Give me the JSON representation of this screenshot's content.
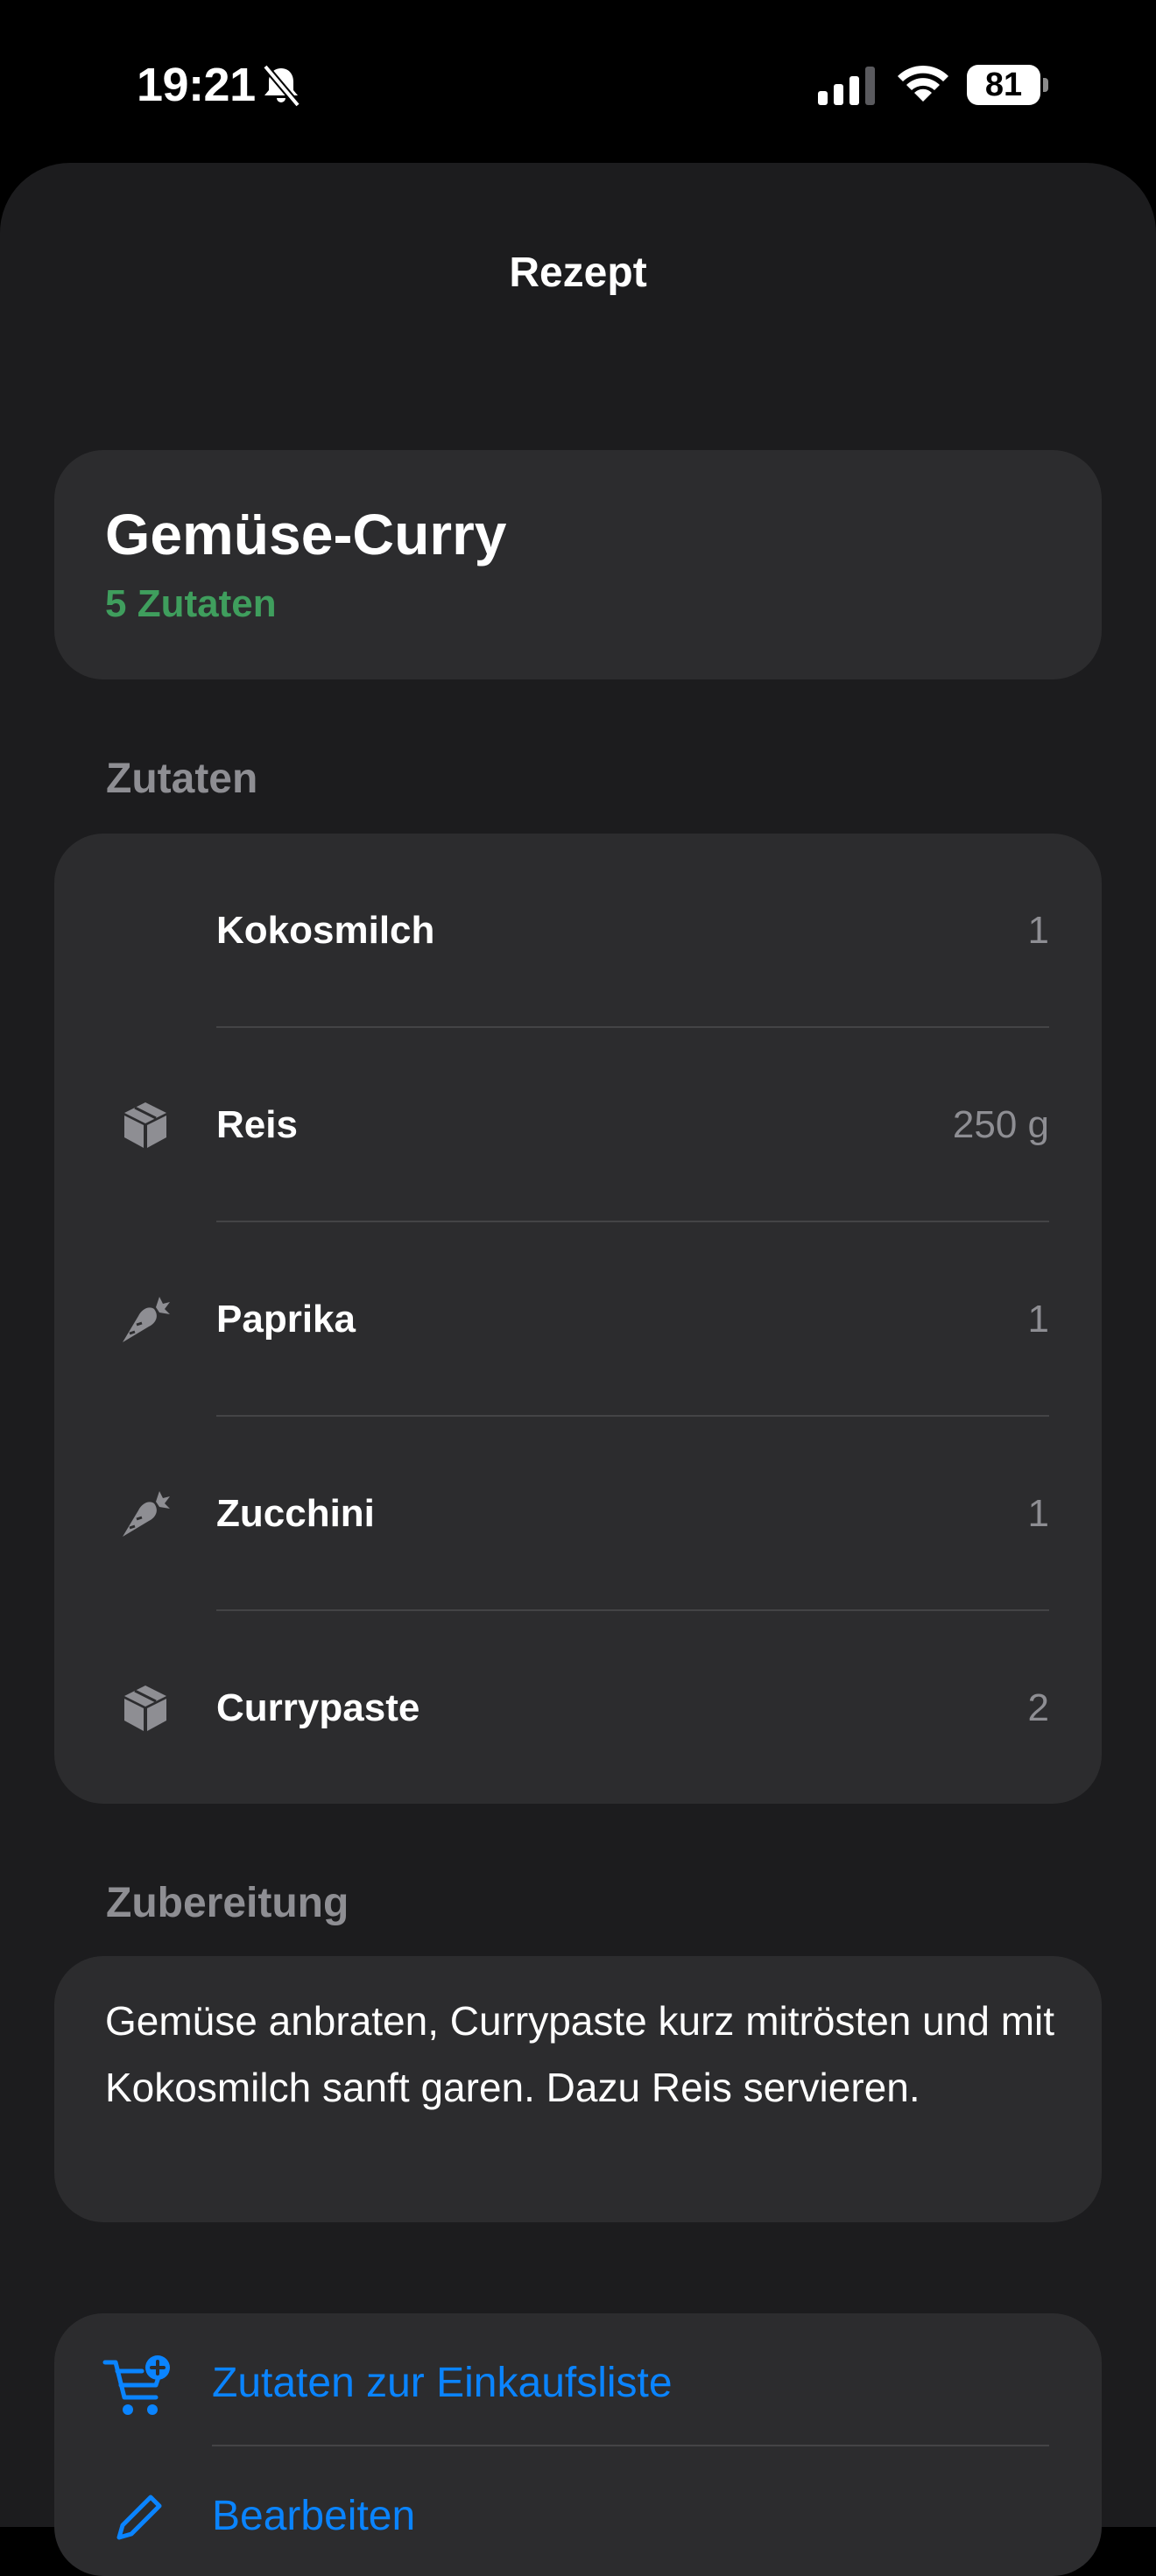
{
  "status_bar": {
    "time": "19:21",
    "battery_level": "81",
    "icons": [
      "bell-slash-icon",
      "cellular-signal-icon",
      "wifi-icon",
      "battery-icon"
    ]
  },
  "nav": {
    "title": "Rezept"
  },
  "recipe": {
    "name": "Gemüse-Curry",
    "ingredient_count": "5 Zutaten",
    "accent_color": "#3f9e5d"
  },
  "ingredients": {
    "header": "Zutaten",
    "items": [
      {
        "name": "Kokosmilch",
        "quantity": "1",
        "icon": ""
      },
      {
        "name": "Reis",
        "quantity": "250 g",
        "icon": "package-icon"
      },
      {
        "name": "Paprika",
        "quantity": "1",
        "icon": "carrot-icon"
      },
      {
        "name": "Zucchini",
        "quantity": "1",
        "icon": "carrot-icon"
      },
      {
        "name": "Currypaste",
        "quantity": "2",
        "icon": "package-icon"
      }
    ]
  },
  "preparation": {
    "header": "Zubereitung",
    "text": "Gemüse anbraten, Currypaste kurz mitrösten und mit Kokosmilch sanft garen. Dazu Reis servieren."
  },
  "actions": {
    "add_to_shopping_list": "Zutaten zur Einkaufsliste",
    "edit": "Bearbeiten",
    "link_color": "#0a84ff"
  }
}
